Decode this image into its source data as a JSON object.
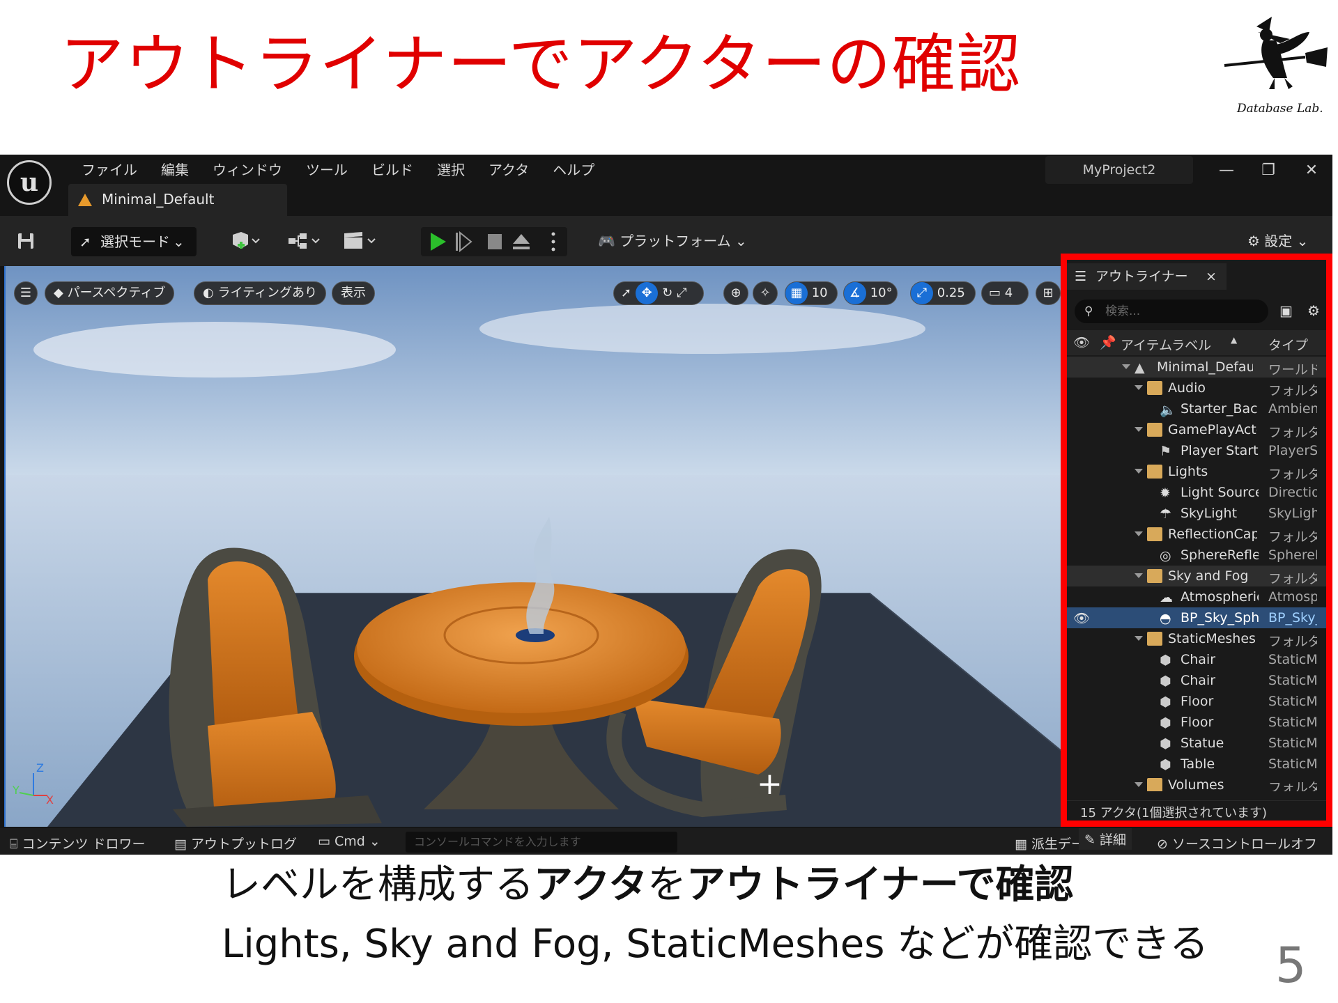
{
  "slide": {
    "title": "アウトライナーでアクターの確認",
    "logo_text": "Database Lab.",
    "caption1_a": "レベルを構成する",
    "caption1_b": "アクタ",
    "caption1_c": "を",
    "caption1_d": "アウトライナーで確認",
    "caption2": "Lights, Sky and Fog, StaticMeshes などが確認できる",
    "page_number": "5"
  },
  "editor": {
    "menu": [
      "ファイル",
      "編集",
      "ウィンドウ",
      "ツール",
      "ビルド",
      "選択",
      "アクタ",
      "ヘルプ"
    ],
    "level_tab": "Minimal_Default",
    "project_name": "MyProject2",
    "window_buttons": {
      "minimize": "—",
      "restore": "❐",
      "close": "✕"
    },
    "toolbar": {
      "select_mode": "選択モード",
      "platforms": "プラットフォーム",
      "settings": "設定"
    },
    "viewport": {
      "perspective": "パースペクティブ",
      "lighting": "ライティングあり",
      "show": "表示",
      "grid_snap": "10",
      "rotation_snap": "10°",
      "scale_snap": "0.25",
      "camera_speed": "4"
    },
    "outliner": {
      "tab_label": "アウトライナー",
      "search_placeholder": "検索...",
      "col_label": "アイテムラベル",
      "col_type": "タイプ",
      "rows": [
        {
          "label": "Minimal_Default",
          "type": "ワールド"
        },
        {
          "label": "Audio",
          "type": "フォルダ"
        },
        {
          "label": "Starter_Background",
          "type": "AmbientSound"
        },
        {
          "label": "GamePlayActors",
          "type": "フォルダ"
        },
        {
          "label": "Player Start",
          "type": "PlayerStart"
        },
        {
          "label": "Lights",
          "type": "フォルダ"
        },
        {
          "label": "Light Source",
          "type": "DirectionalLight"
        },
        {
          "label": "SkyLight",
          "type": "SkyLight"
        },
        {
          "label": "ReflectionCaptureActors",
          "type": "フォルダ"
        },
        {
          "label": "SphereReflectionCapture",
          "type": "SphereReflectionCapture"
        },
        {
          "label": "Sky and Fog",
          "type": "フォルダ"
        },
        {
          "label": "AtmosphericFog",
          "type": "AtmosphericFog"
        },
        {
          "label": "BP_Sky_Sphere",
          "type": "BP_Sky_Sphere"
        },
        {
          "label": "StaticMeshes",
          "type": "フォルダ"
        },
        {
          "label": "Chair",
          "type": "StaticMeshActor"
        },
        {
          "label": "Chair",
          "type": "StaticMeshActor"
        },
        {
          "label": "Floor",
          "type": "StaticMeshActor"
        },
        {
          "label": "Floor",
          "type": "StaticMeshActor"
        },
        {
          "label": "Statue",
          "type": "StaticMeshActor"
        },
        {
          "label": "Table",
          "type": "StaticMeshActor"
        },
        {
          "label": "Volumes",
          "type": "フォルダ"
        }
      ],
      "footer": "15 アクタ(1個選択されています)"
    },
    "statusbar": {
      "content_drawer": "コンテンツ ドロワー",
      "output_log": "アウトプットログ",
      "cmd": "Cmd",
      "console_placeholder": "コンソールコマンドを入力します",
      "derived_data": "派生データ",
      "details": "詳細",
      "source_control": "ソースコントロールオフ"
    },
    "colors": {
      "title_red": "#e00000",
      "highlight_red": "#ff0000",
      "selection_blue": "#2c4d77",
      "play_green": "#2bbf2b"
    }
  }
}
